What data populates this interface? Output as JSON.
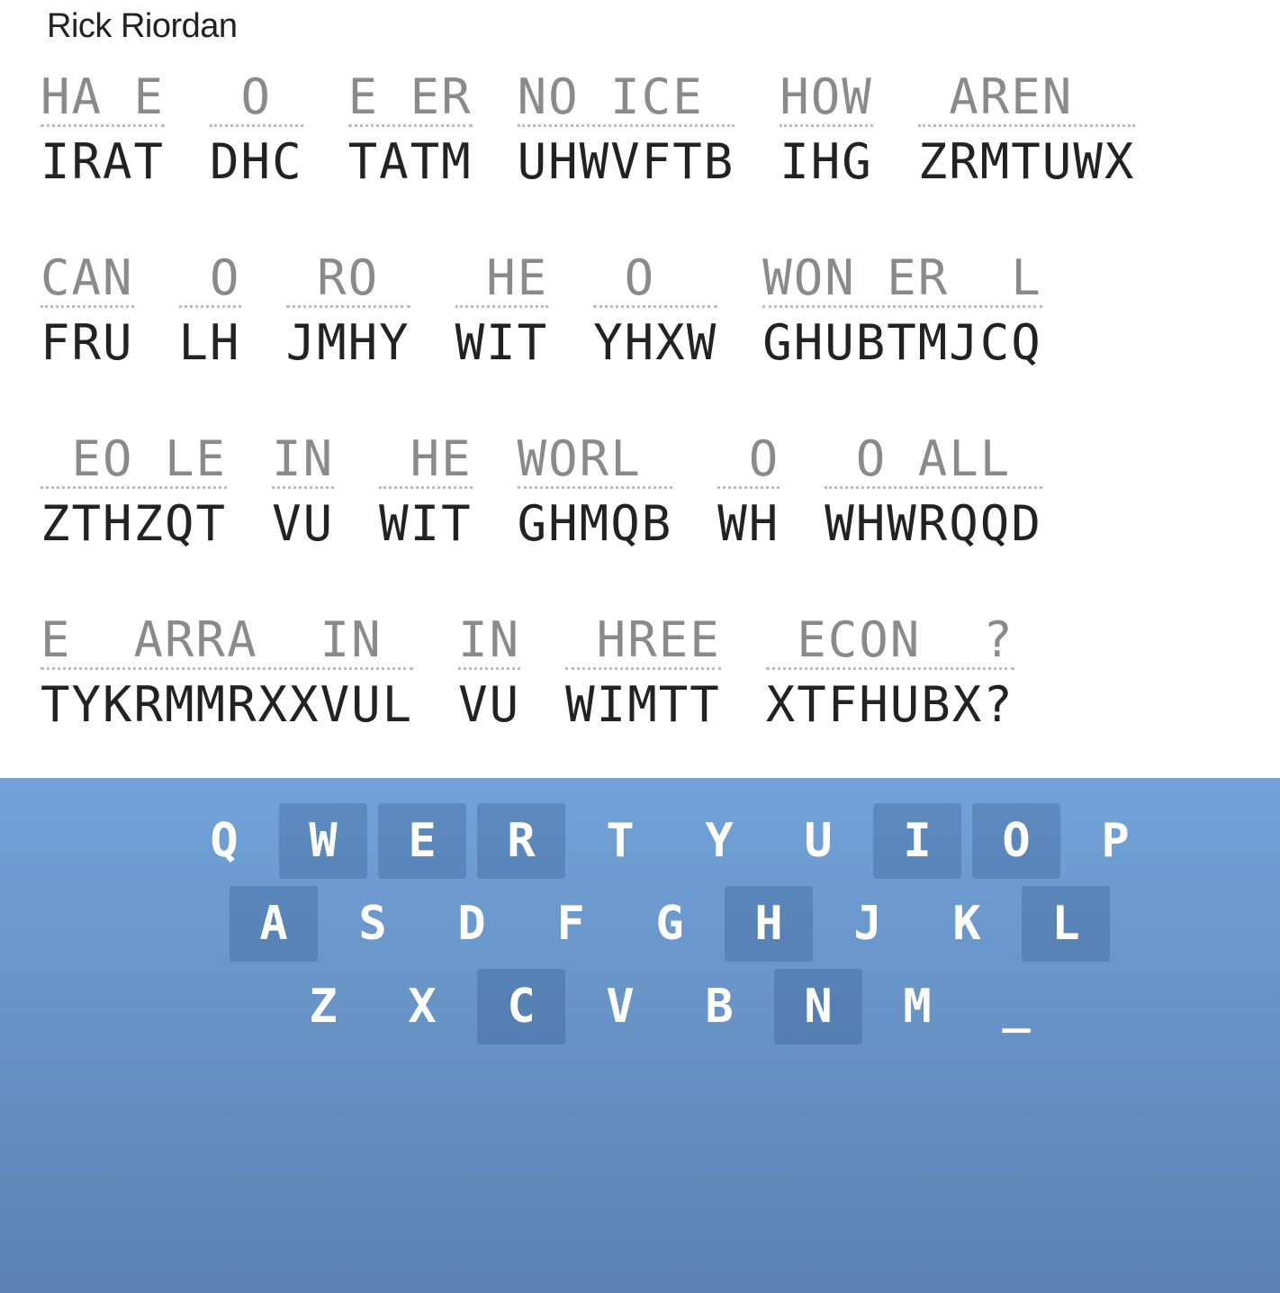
{
  "author": "Rick Riordan",
  "puzzle": {
    "lines": [
      [
        {
          "guess": "HA E",
          "cipher": "IRAT"
        },
        {
          "guess": " O ",
          "cipher": "DHC"
        },
        {
          "guess": "E ER",
          "cipher": "TATM"
        },
        {
          "guess": "NO ICE ",
          "cipher": "UHWVFTB"
        },
        {
          "guess": "HOW",
          "cipher": "IHG"
        },
        {
          "guess": " AREN  ",
          "cipher": "ZRMTUWX"
        }
      ],
      [
        {
          "guess": "CAN",
          "cipher": "FRU"
        },
        {
          "guess": " O",
          "cipher": "LH"
        },
        {
          "guess": " RO ",
          "cipher": "JMHY"
        },
        {
          "guess": " HE",
          "cipher": "WIT"
        },
        {
          "guess": " O  ",
          "cipher": "YHXW"
        },
        {
          "guess": "WON ER  L",
          "cipher": "GHUBTMJCQ"
        }
      ],
      [
        {
          "guess": " EO LE",
          "cipher": "ZTHZQT"
        },
        {
          "guess": "IN",
          "cipher": "VU"
        },
        {
          "guess": " HE",
          "cipher": "WIT"
        },
        {
          "guess": "WORL ",
          "cipher": "GHMQB"
        },
        {
          "guess": " O",
          "cipher": "WH"
        },
        {
          "guess": " O ALL ",
          "cipher": "WHWRQQD"
        }
      ],
      [
        {
          "guess": "E  ARRA  IN ",
          "cipher": "TYKRMMRXXVUL"
        },
        {
          "guess": "IN",
          "cipher": "VU"
        },
        {
          "guess": " HREE",
          "cipher": "WIMTT"
        },
        {
          "guess": " ECON  ?",
          "cipher": "XTFHUBX?"
        }
      ]
    ]
  },
  "keyboard": {
    "rows": [
      [
        {
          "label": "Q",
          "used": false
        },
        {
          "label": "W",
          "used": true
        },
        {
          "label": "E",
          "used": true
        },
        {
          "label": "R",
          "used": true
        },
        {
          "label": "T",
          "used": false
        },
        {
          "label": "Y",
          "used": false
        },
        {
          "label": "U",
          "used": false
        },
        {
          "label": "I",
          "used": true
        },
        {
          "label": "O",
          "used": true
        },
        {
          "label": "P",
          "used": false
        }
      ],
      [
        {
          "label": "A",
          "used": true
        },
        {
          "label": "S",
          "used": false
        },
        {
          "label": "D",
          "used": false
        },
        {
          "label": "F",
          "used": false
        },
        {
          "label": "G",
          "used": false
        },
        {
          "label": "H",
          "used": true
        },
        {
          "label": "J",
          "used": false
        },
        {
          "label": "K",
          "used": false
        },
        {
          "label": "L",
          "used": true
        }
      ],
      [
        {
          "label": "Z",
          "used": false
        },
        {
          "label": "X",
          "used": false
        },
        {
          "label": "C",
          "used": true
        },
        {
          "label": "V",
          "used": false
        },
        {
          "label": "B",
          "used": false
        },
        {
          "label": "N",
          "used": true
        },
        {
          "label": "M",
          "used": false
        },
        {
          "label": "_",
          "used": false
        }
      ]
    ]
  }
}
